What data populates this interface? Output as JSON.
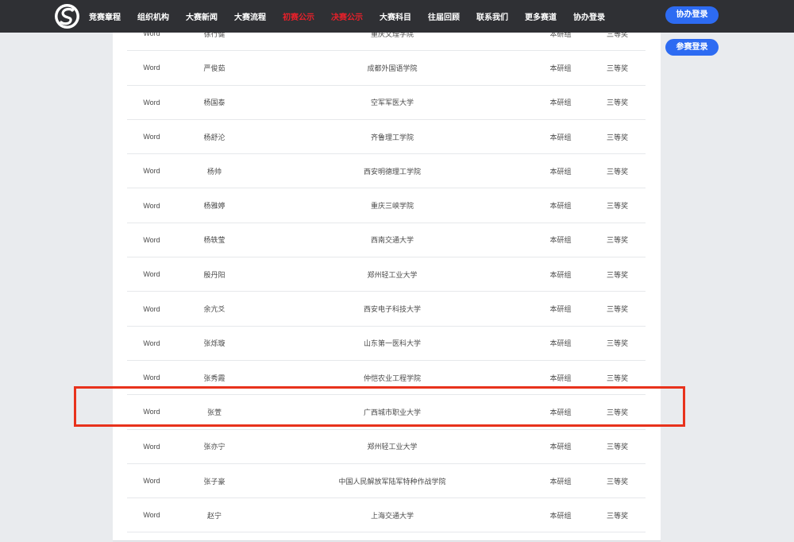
{
  "nav": {
    "items": [
      {
        "label": "竞赛章程",
        "highlight": false
      },
      {
        "label": "组织机构",
        "highlight": false
      },
      {
        "label": "大赛新闻",
        "highlight": false
      },
      {
        "label": "大赛流程",
        "highlight": false
      },
      {
        "label": "初赛公示",
        "highlight": true
      },
      {
        "label": "决赛公示",
        "highlight": true
      },
      {
        "label": "大赛科目",
        "highlight": false
      },
      {
        "label": "往届回顾",
        "highlight": false
      },
      {
        "label": "联系我们",
        "highlight": false
      },
      {
        "label": "更多赛道",
        "highlight": false
      },
      {
        "label": "协办登录",
        "highlight": false
      }
    ]
  },
  "buttons": {
    "top_login": "协办登录",
    "side_login": "参赛登录"
  },
  "colors": {
    "topbar": "#2f3034",
    "accent_button": "#2d6bf2",
    "highlight_nav": "#e8202a",
    "highlight_box": "#e8321c"
  },
  "table": {
    "rows": [
      {
        "subject": "Word",
        "name": "徐行健",
        "school": "重庆文理学院",
        "group": "本研组",
        "award": "三等奖"
      },
      {
        "subject": "Word",
        "name": "严俊茹",
        "school": "成都外国语学院",
        "group": "本研组",
        "award": "三等奖"
      },
      {
        "subject": "Word",
        "name": "杨国泰",
        "school": "空军军医大学",
        "group": "本研组",
        "award": "三等奖"
      },
      {
        "subject": "Word",
        "name": "杨舒沦",
        "school": "齐鲁理工学院",
        "group": "本研组",
        "award": "三等奖"
      },
      {
        "subject": "Word",
        "name": "杨帅",
        "school": "西安明德理工学院",
        "group": "本研组",
        "award": "三等奖"
      },
      {
        "subject": "Word",
        "name": "杨雅婷",
        "school": "重庆三峡学院",
        "group": "本研组",
        "award": "三等奖"
      },
      {
        "subject": "Word",
        "name": "杨轶莹",
        "school": "西南交通大学",
        "group": "本研组",
        "award": "三等奖"
      },
      {
        "subject": "Word",
        "name": "殷丹阳",
        "school": "郑州轻工业大学",
        "group": "本研组",
        "award": "三等奖"
      },
      {
        "subject": "Word",
        "name": "余亢爻",
        "school": "西安电子科技大学",
        "group": "本研组",
        "award": "三等奖"
      },
      {
        "subject": "Word",
        "name": "张烁璇",
        "school": "山东第一医科大学",
        "group": "本研组",
        "award": "三等奖"
      },
      {
        "subject": "Word",
        "name": "张秀霞",
        "school": "仲恺农业工程学院",
        "group": "本研组",
        "award": "三等奖"
      },
      {
        "subject": "Word",
        "name": "张萱",
        "school": "广西城市职业大学",
        "group": "本研组",
        "award": "三等奖"
      },
      {
        "subject": "Word",
        "name": "张亦宁",
        "school": "郑州轻工业大学",
        "group": "本研组",
        "award": "三等奖"
      },
      {
        "subject": "Word",
        "name": "张子豪",
        "school": "中国人民解放军陆军特种作战学院",
        "group": "本研组",
        "award": "三等奖"
      },
      {
        "subject": "Word",
        "name": "赵宁",
        "school": "上海交通大学",
        "group": "本研组",
        "award": "三等奖"
      }
    ]
  }
}
